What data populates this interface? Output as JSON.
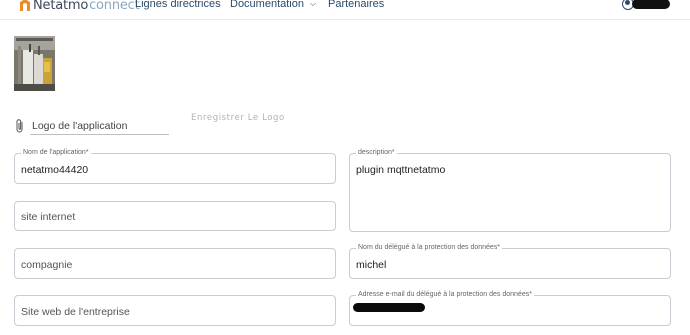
{
  "brand": {
    "name": "Netatmo",
    "suffix": "connect",
    "color": "#f08a24"
  },
  "nav": {
    "links": [
      "Lignes directrices",
      "Documentation",
      "Partenaires"
    ],
    "documentation_has_dropdown": true
  },
  "logo_upload": {
    "label": "Logo de l'application",
    "save_button": "Enregistrer Le Logo"
  },
  "form": {
    "app_name": {
      "label": "Nom de l'application*",
      "value": "netatmo44420"
    },
    "description": {
      "label": "description*",
      "value": "plugin mqttnetatmo"
    },
    "website": {
      "placeholder": "site internet"
    },
    "company": {
      "placeholder": "compagnie"
    },
    "dpo_name": {
      "label": "Nom du délégué à la protection des données*",
      "value": "michel"
    },
    "company_website": {
      "placeholder": "Site web de l'entreprise"
    },
    "dpo_email": {
      "label": "Adresse e-mail du délégué à la protection des données*"
    }
  },
  "icons": {
    "attachment": "paperclip-icon",
    "user": "user-icon",
    "dropdown": "chevron-down-icon"
  }
}
